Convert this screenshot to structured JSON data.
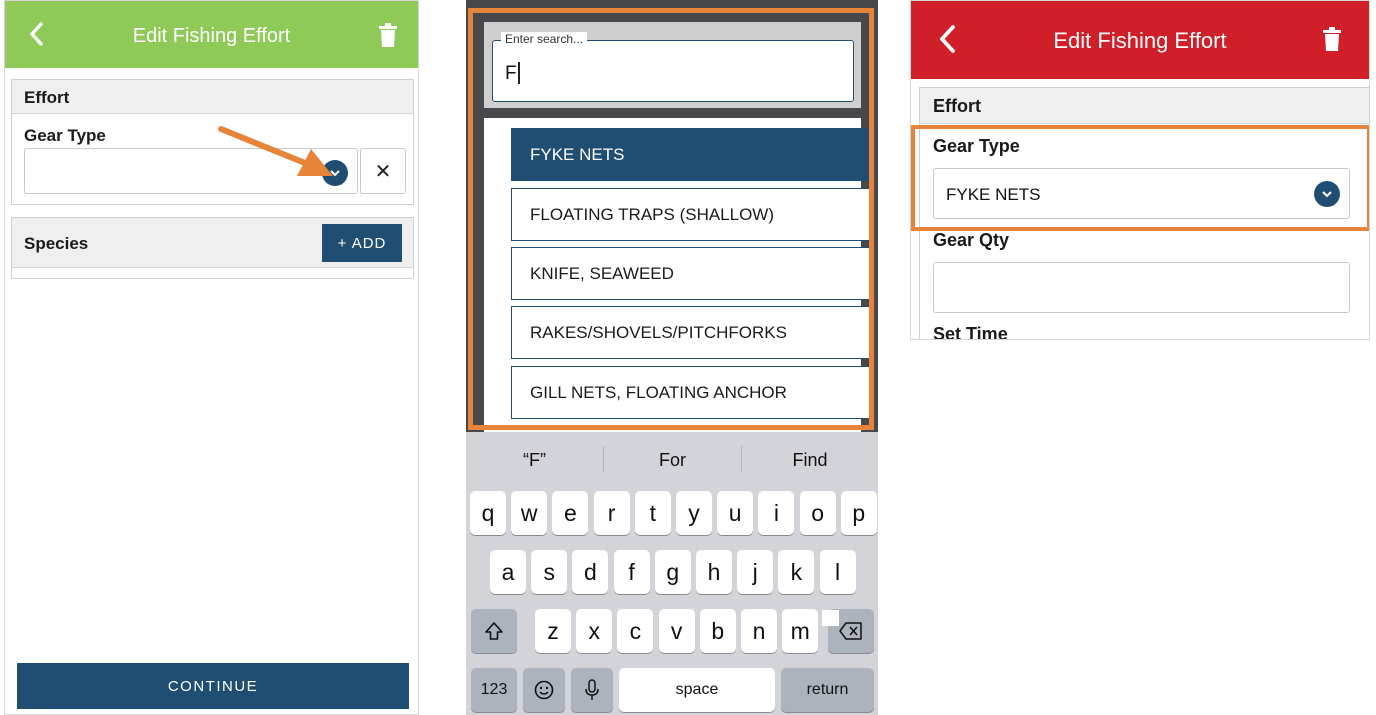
{
  "panel1": {
    "title": "Edit Fishing Effort",
    "effort_label": "Effort",
    "gear_type_label": "Gear Type",
    "gear_type_value": "",
    "clear_symbol": "✕",
    "species_label": "Species",
    "add_label": "+ ADD",
    "continue_label": "CONTINUE"
  },
  "panel2": {
    "search_placeholder": "Enter search...",
    "search_value": "F",
    "options": [
      "FYKE NETS",
      "FLOATING TRAPS (SHALLOW)",
      "KNIFE, SEAWEED",
      "RAKES/SHOVELS/PITCHFORKS",
      "GILL NETS, FLOATING ANCHOR"
    ],
    "suggestions": [
      "“F”",
      "For",
      "Find"
    ],
    "keyboard": {
      "row1": [
        "q",
        "w",
        "e",
        "r",
        "t",
        "y",
        "u",
        "i",
        "o",
        "p"
      ],
      "row2": [
        "a",
        "s",
        "d",
        "f",
        "g",
        "h",
        "j",
        "k",
        "l"
      ],
      "row3": [
        "z",
        "x",
        "c",
        "v",
        "b",
        "n",
        "m"
      ],
      "numbers_label": "123",
      "space_label": "space",
      "return_label": "return"
    }
  },
  "panel3": {
    "title": "Edit Fishing Effort",
    "effort_label": "Effort",
    "gear_type_label": "Gear Type",
    "gear_type_value": "FYKE NETS",
    "gear_qty_label": "Gear Qty",
    "gear_qty_value": "",
    "set_time_label": "Set Time"
  },
  "colors": {
    "header_green": "#8fca58",
    "header_red": "#d11f2a",
    "navy": "#1f4e72",
    "highlight_orange": "#e8833a"
  },
  "icons": [
    "back-chevron-icon",
    "trash-icon",
    "chevron-down-icon",
    "close-icon",
    "shift-icon",
    "backspace-icon",
    "emoji-icon",
    "microphone-icon"
  ]
}
